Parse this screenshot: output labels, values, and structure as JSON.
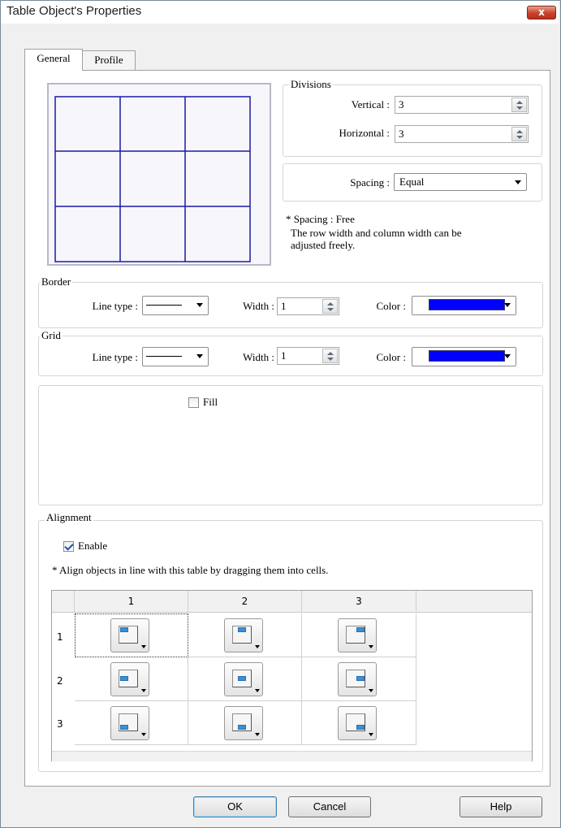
{
  "window": {
    "title": "Table Object's Properties",
    "close_glyph": "x"
  },
  "tabs": [
    {
      "label": "General",
      "active": true
    },
    {
      "label": "Profile",
      "active": false
    }
  ],
  "divisions": {
    "title": "Divisions",
    "vertical_label": "Vertical :",
    "vertical_value": "3",
    "horizontal_label": "Horizontal :",
    "horizontal_value": "3"
  },
  "spacing": {
    "label": "Spacing :",
    "value": "Equal",
    "note_title": "* Spacing : Free",
    "note_line1": "The row width and column width can be",
    "note_line2": "adjusted freely."
  },
  "border": {
    "title": "Border",
    "line_type_label": "Line type :",
    "width_label": "Width :",
    "width_value": "1",
    "color_label": "Color :",
    "color": "#0000ff"
  },
  "grid": {
    "title": "Grid",
    "line_type_label": "Line type :",
    "width_label": "Width :",
    "width_value": "1",
    "color_label": "Color :",
    "color": "#0000ff"
  },
  "fill": {
    "label": "Fill",
    "checked": false
  },
  "alignment": {
    "title": "Alignment",
    "enable_label": "Enable",
    "enabled": true,
    "note": "* Align objects in line with this table by dragging them into cells.",
    "columns": [
      "1",
      "2",
      "3"
    ],
    "rows": [
      "1",
      "2",
      "3"
    ]
  },
  "preview": {
    "grid_rows": 3,
    "grid_cols": 3,
    "line_color": "#1a1aa6"
  },
  "buttons": {
    "ok": "OK",
    "cancel": "Cancel",
    "help": "Help"
  }
}
